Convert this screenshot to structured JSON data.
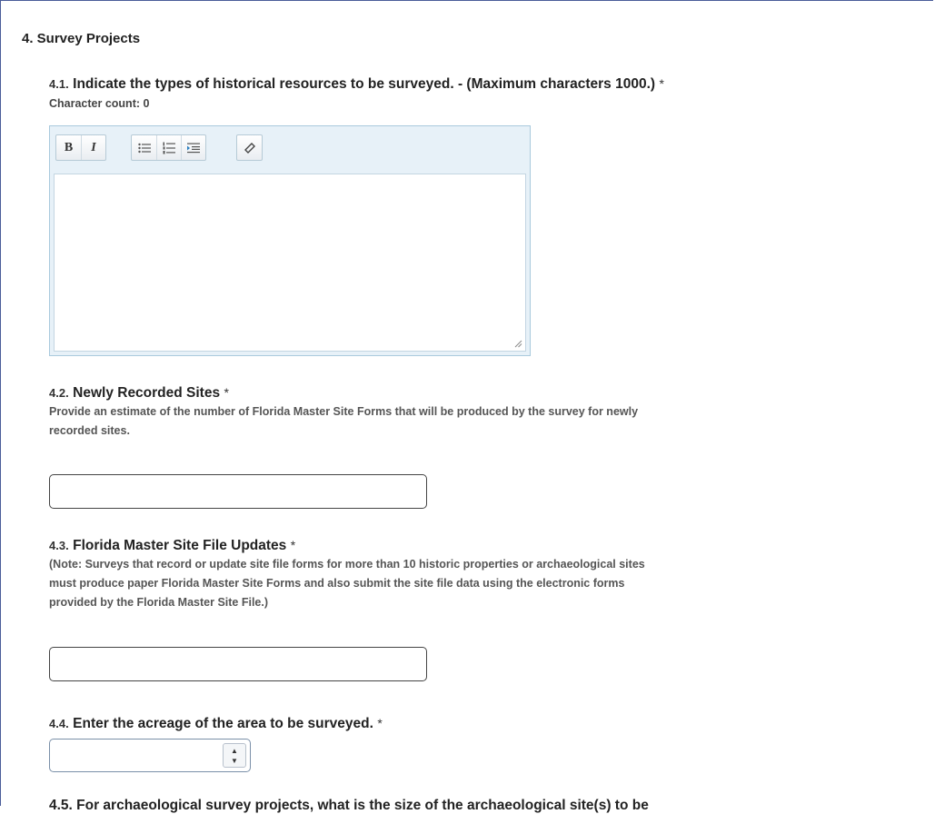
{
  "section": {
    "title": "4. Survey Projects"
  },
  "q41": {
    "num": "4.1.",
    "title": "Indicate the types of historical resources to be surveyed. - (Maximum characters 1000.)",
    "required": "*",
    "char_count": "Character count: 0",
    "toolbar": {
      "bold": "B",
      "italic": "I",
      "bullet_icon": "bulleted-list-icon",
      "numbered_icon": "numbered-list-icon",
      "indent_icon": "indent-icon",
      "clear_icon": "eraser-icon"
    },
    "value": ""
  },
  "q42": {
    "num": "4.2.",
    "title": "Newly Recorded Sites",
    "required": "*",
    "help_line1": "Provide an estimate of the number of Florida Master Site Forms that will be produced by the survey for newly",
    "help_line2": "recorded sites.",
    "value": ""
  },
  "q43": {
    "num": "4.3.",
    "title": "Florida Master Site File Updates",
    "required": "*",
    "note_line1": "(Note: Surveys that record or update site file forms for more than 10 historic properties or archaeological sites",
    "note_line2": "must produce paper Florida Master Site Forms and also submit the site file data using the electronic forms",
    "note_line3": "provided by the Florida Master Site File.)",
    "value": ""
  },
  "q44": {
    "num": "4.4.",
    "title": "Enter the acreage of the area to be surveyed.",
    "required": "*",
    "value": ""
  },
  "q45": {
    "partial_text": "4.5. For archaeological survey projects, what is the size of the archaeological site(s) to be"
  }
}
